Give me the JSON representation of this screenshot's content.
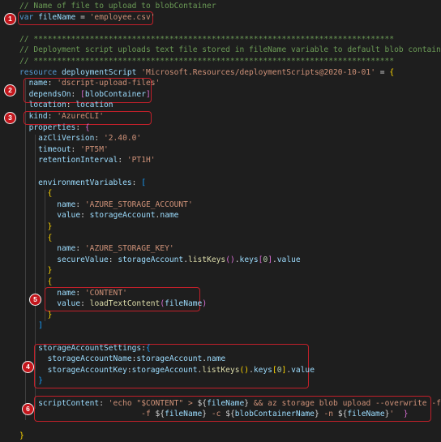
{
  "lines": [
    [
      [
        "c-comment",
        "// Name of file to upload to blobContainer"
      ]
    ],
    [
      [
        "c-keyword",
        "var "
      ],
      [
        "c-ident",
        "fileName"
      ],
      [
        "c-plain",
        " = "
      ],
      [
        "c-string",
        "'employee.csv'"
      ]
    ],
    [],
    [
      [
        "c-comment",
        "// *****************************************************************************"
      ]
    ],
    [
      [
        "c-comment",
        "// Deployment script uploads text file stored in fileName variable to default blob container"
      ]
    ],
    [
      [
        "c-comment",
        "// *****************************************************************************"
      ]
    ],
    [
      [
        "c-keyword",
        "resource "
      ],
      [
        "c-ident",
        "deploymentScript "
      ],
      [
        "c-string",
        "'Microsoft.Resources/deploymentScripts@2020-10-01'"
      ],
      [
        "c-plain",
        " = "
      ],
      [
        "c-brace",
        "{"
      ]
    ],
    [
      [
        "c-plain",
        "  "
      ],
      [
        "c-prop",
        "name"
      ],
      [
        "c-plain",
        ": "
      ],
      [
        "c-string",
        "'dscript-upload-files'"
      ]
    ],
    [
      [
        "c-plain",
        "  "
      ],
      [
        "c-prop",
        "dependsOn"
      ],
      [
        "c-plain",
        ": "
      ],
      [
        "c-brace2",
        "["
      ],
      [
        "c-ident",
        "blobContainer"
      ],
      [
        "c-brace2",
        "]"
      ]
    ],
    [
      [
        "c-plain",
        "  "
      ],
      [
        "c-prop",
        "location"
      ],
      [
        "c-plain",
        ": "
      ],
      [
        "c-ident",
        "location"
      ]
    ],
    [
      [
        "c-plain",
        "  "
      ],
      [
        "c-prop",
        "kind"
      ],
      [
        "c-plain",
        ": "
      ],
      [
        "c-string",
        "'AzureCLI'"
      ]
    ],
    [
      [
        "c-plain",
        "  "
      ],
      [
        "c-prop",
        "properties"
      ],
      [
        "c-plain",
        ": "
      ],
      [
        "c-brace2",
        "{"
      ]
    ],
    [
      [
        "c-plain",
        "    "
      ],
      [
        "c-prop",
        "azCliVersion"
      ],
      [
        "c-plain",
        ": "
      ],
      [
        "c-string",
        "'2.40.0'"
      ]
    ],
    [
      [
        "c-plain",
        "    "
      ],
      [
        "c-prop",
        "timeout"
      ],
      [
        "c-plain",
        ": "
      ],
      [
        "c-string",
        "'PT5M'"
      ]
    ],
    [
      [
        "c-plain",
        "    "
      ],
      [
        "c-prop",
        "retentionInterval"
      ],
      [
        "c-plain",
        ": "
      ],
      [
        "c-string",
        "'PT1H'"
      ]
    ],
    [],
    [
      [
        "c-plain",
        "    "
      ],
      [
        "c-prop",
        "environmentVariables"
      ],
      [
        "c-plain",
        ": "
      ],
      [
        "c-brace3",
        "["
      ]
    ],
    [
      [
        "c-plain",
        "      "
      ],
      [
        "c-brace",
        "{"
      ]
    ],
    [
      [
        "c-plain",
        "        "
      ],
      [
        "c-prop",
        "name"
      ],
      [
        "c-plain",
        ": "
      ],
      [
        "c-string",
        "'AZURE_STORAGE_ACCOUNT'"
      ]
    ],
    [
      [
        "c-plain",
        "        "
      ],
      [
        "c-prop",
        "value"
      ],
      [
        "c-plain",
        ": "
      ],
      [
        "c-ident",
        "storageAccount"
      ],
      [
        "c-plain",
        "."
      ],
      [
        "c-ident",
        "name"
      ]
    ],
    [
      [
        "c-plain",
        "      "
      ],
      [
        "c-brace",
        "}"
      ]
    ],
    [
      [
        "c-plain",
        "      "
      ],
      [
        "c-brace",
        "{"
      ]
    ],
    [
      [
        "c-plain",
        "        "
      ],
      [
        "c-prop",
        "name"
      ],
      [
        "c-plain",
        ": "
      ],
      [
        "c-string",
        "'AZURE_STORAGE_KEY'"
      ]
    ],
    [
      [
        "c-plain",
        "        "
      ],
      [
        "c-prop",
        "secureValue"
      ],
      [
        "c-plain",
        ": "
      ],
      [
        "c-ident",
        "storageAccount"
      ],
      [
        "c-plain",
        "."
      ],
      [
        "c-func",
        "listKeys"
      ],
      [
        "c-brace2",
        "()"
      ],
      [
        "c-plain",
        "."
      ],
      [
        "c-ident",
        "keys"
      ],
      [
        "c-brace2",
        "["
      ],
      [
        "c-number",
        "0"
      ],
      [
        "c-brace2",
        "]"
      ],
      [
        "c-plain",
        "."
      ],
      [
        "c-ident",
        "value"
      ]
    ],
    [
      [
        "c-plain",
        "      "
      ],
      [
        "c-brace",
        "}"
      ]
    ],
    [
      [
        "c-plain",
        "      "
      ],
      [
        "c-brace",
        "{"
      ]
    ],
    [
      [
        "c-plain",
        "        "
      ],
      [
        "c-prop",
        "name"
      ],
      [
        "c-plain",
        ": "
      ],
      [
        "c-string",
        "'CONTENT'"
      ]
    ],
    [
      [
        "c-plain",
        "        "
      ],
      [
        "c-prop",
        "value"
      ],
      [
        "c-plain",
        ": "
      ],
      [
        "c-func",
        "loadTextContent"
      ],
      [
        "c-brace2",
        "("
      ],
      [
        "c-ident",
        "fileName"
      ],
      [
        "c-brace2",
        ")"
      ]
    ],
    [
      [
        "c-plain",
        "      "
      ],
      [
        "c-brace",
        "}"
      ]
    ],
    [
      [
        "c-plain",
        "    "
      ],
      [
        "c-brace3",
        "]"
      ]
    ],
    [],
    [
      [
        "c-plain",
        "    "
      ],
      [
        "c-prop",
        "storageAccountSettings"
      ],
      [
        "c-plain",
        ":"
      ],
      [
        "c-brace3",
        "{"
      ]
    ],
    [
      [
        "c-plain",
        "      "
      ],
      [
        "c-prop",
        "storageAccountName"
      ],
      [
        "c-plain",
        ":"
      ],
      [
        "c-ident",
        "storageAccount"
      ],
      [
        "c-plain",
        "."
      ],
      [
        "c-ident",
        "name"
      ]
    ],
    [
      [
        "c-plain",
        "      "
      ],
      [
        "c-prop",
        "storageAccountKey"
      ],
      [
        "c-plain",
        ":"
      ],
      [
        "c-ident",
        "storageAccount"
      ],
      [
        "c-plain",
        "."
      ],
      [
        "c-func",
        "listKeys"
      ],
      [
        "c-brace",
        "()"
      ],
      [
        "c-plain",
        "."
      ],
      [
        "c-ident",
        "keys"
      ],
      [
        "c-brace",
        "["
      ],
      [
        "c-number",
        "0"
      ],
      [
        "c-brace",
        "]"
      ],
      [
        "c-plain",
        "."
      ],
      [
        "c-ident",
        "value"
      ]
    ],
    [
      [
        "c-plain",
        "    "
      ],
      [
        "c-brace3",
        "}"
      ]
    ],
    [],
    [
      [
        "c-plain",
        "    "
      ],
      [
        "c-prop",
        "scriptContent"
      ],
      [
        "c-plain",
        ": "
      ],
      [
        "c-string",
        "'echo \"$CONTENT\" > "
      ],
      [
        "c-plain",
        "${"
      ],
      [
        "c-ident",
        "fileName"
      ],
      [
        "c-plain",
        "}"
      ],
      [
        "c-string",
        " && az storage blob upload --overwrite -f"
      ]
    ],
    [
      [
        "c-string",
        "                          -f "
      ],
      [
        "c-plain",
        "${"
      ],
      [
        "c-ident",
        "fileName"
      ],
      [
        "c-plain",
        "}"
      ],
      [
        "c-string",
        " -c "
      ],
      [
        "c-plain",
        "${"
      ],
      [
        "c-ident",
        "blobContainerName"
      ],
      [
        "c-plain",
        "}"
      ],
      [
        "c-string",
        " -n "
      ],
      [
        "c-plain",
        "${"
      ],
      [
        "c-ident",
        "fileName"
      ],
      [
        "c-plain",
        "}"
      ],
      [
        "c-string",
        "'  "
      ],
      [
        "c-brace2",
        "}"
      ]
    ],
    [],
    [
      [
        "c-brace",
        "}"
      ]
    ]
  ],
  "callouts": [
    "1",
    "2",
    "3",
    "4",
    "5",
    "6"
  ]
}
